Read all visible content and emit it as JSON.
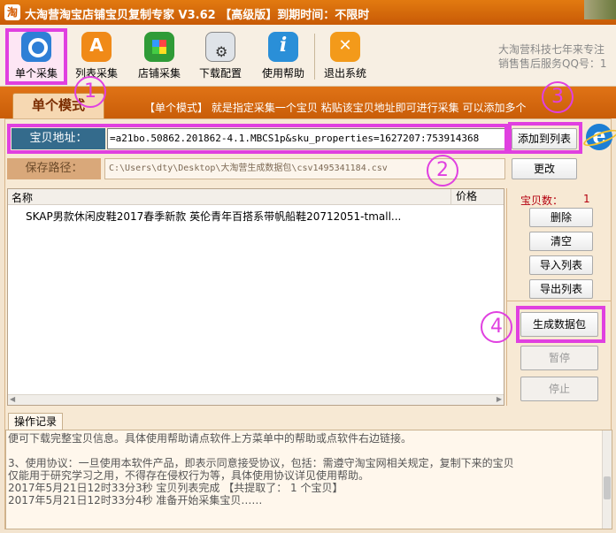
{
  "window": {
    "title": "大淘营淘宝店铺宝贝复制专家 V3.62 【高级版】到期时间：不限时",
    "app_icon": "淘"
  },
  "toolbar": {
    "items": [
      {
        "label": "单个采集",
        "icon": "magnifier-icon"
      },
      {
        "label": "列表采集",
        "icon": "list-collect-icon"
      },
      {
        "label": "店铺采集",
        "icon": "shop-icon"
      },
      {
        "label": "下载配置",
        "icon": "download-config-icon"
      },
      {
        "label": "使用帮助",
        "icon": "help-icon"
      },
      {
        "label": "退出系统",
        "icon": "exit-icon"
      }
    ],
    "promo_line1": "大淘营科技七年来专注",
    "promo_line2": "销售售后服务QQ号：1"
  },
  "mode": {
    "tab_label": "单个模式",
    "description": "【单个模式】 就是指定采集一个宝贝 粘贴该宝贝地址即可进行采集 可以添加多个"
  },
  "form": {
    "url_label": "宝贝地址：",
    "url_value": "=a21bo.50862.201862-4.1.MBCS1p&sku_properties=1627207:753914368",
    "add_button": "添加到列表",
    "path_label": "保存路径：",
    "path_value": "C:\\Users\\dty\\Desktop\\大淘营生成数据包\\csv1495341184.csv",
    "change_button": "更改"
  },
  "table": {
    "columns": [
      "名称",
      "价格"
    ],
    "rows": [
      {
        "name": "SKAP男款休闲皮鞋2017春季新款 英伦青年百搭系带帆船鞋20712051-tmall...",
        "price": ""
      }
    ]
  },
  "side": {
    "count_label": "宝贝数：",
    "count_value": "1",
    "delete": "删除",
    "clear": "清空",
    "import": "导入列表",
    "export": "导出列表",
    "generate": "生成数据包",
    "pause": "暂停",
    "stop": "停止"
  },
  "log": {
    "tab_label": "操作记录",
    "lines": [
      "便可下载完整宝贝信息。具体使用帮助请点软件上方菜单中的帮助或点软件右边链接。",
      "",
      "3、使用协议：一旦使用本软件产品，即表示同意接受协议，包括：需遵守淘宝网相关规定，复制下来的宝贝",
      "仅能用于研究学习之用，不得存在侵权行为等，具体使用协议详见使用帮助。",
      "2017年5月21日12时33分3秒  宝贝列表完成 【共提取了：  1  个宝贝】",
      "2017年5月21日12时33分4秒  准备开始采集宝贝……"
    ]
  },
  "annotations": [
    "1",
    "2",
    "3",
    "4"
  ],
  "colors": {
    "highlight": "#e040e0",
    "title_orange": "#d86a0c",
    "label_blue": "#346b8c",
    "count_red": "#b4000e"
  }
}
